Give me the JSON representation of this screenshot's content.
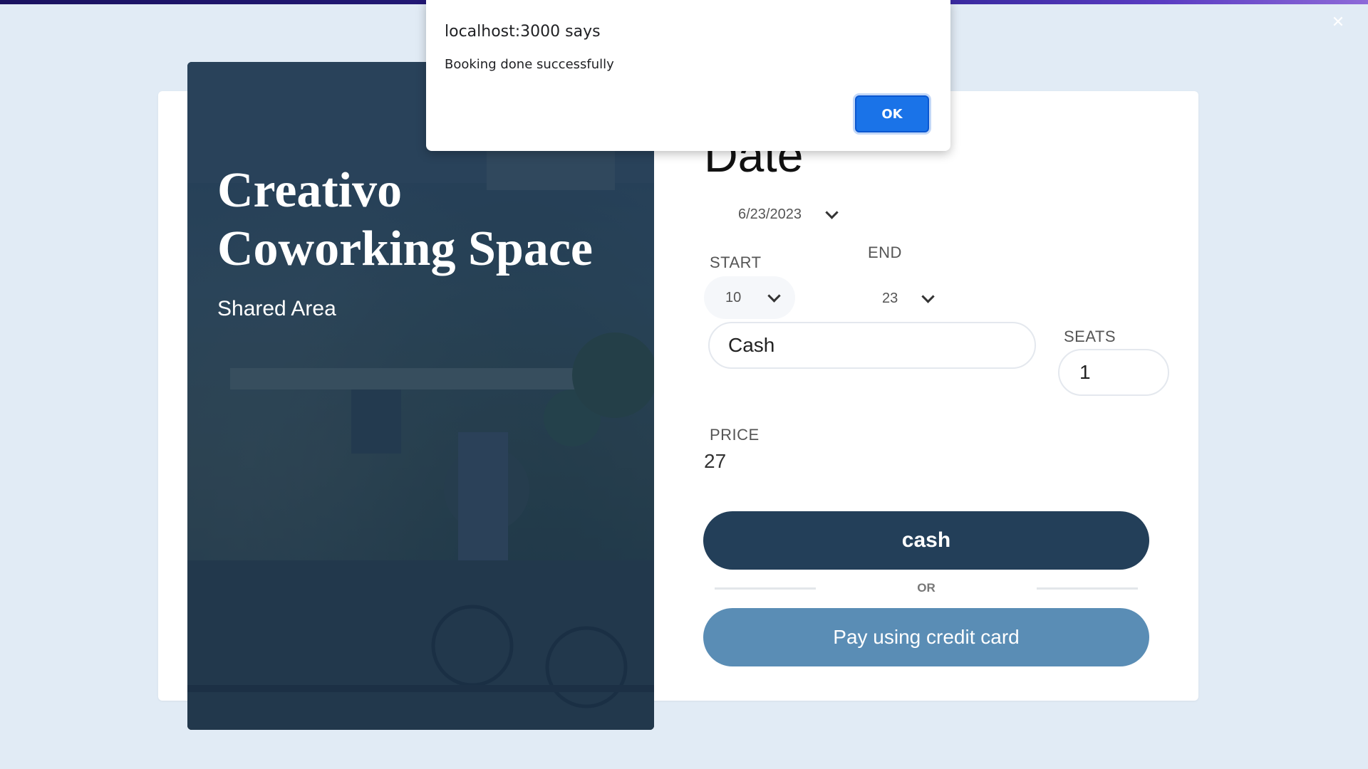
{
  "window": {
    "close_icon": "close-icon",
    "accent_gradient": [
      "#1a1260",
      "#8e6ad8"
    ]
  },
  "hero": {
    "title": "Creativo Coworking Space",
    "subtitle": "Shared Area"
  },
  "booking": {
    "date_heading": "Date",
    "date_value": "6/23/2023",
    "start_label": "START",
    "start_value": "10",
    "end_label": "END",
    "end_value": "23",
    "payment_value": "Cash",
    "seats_label": "SEATS",
    "seats_value": "1",
    "price_label": "PRICE",
    "price_value": "27",
    "cash_button": "cash",
    "or_text": "OR",
    "card_button": "Pay using credit card"
  },
  "alert": {
    "origin": "localhost:3000 says",
    "message": "Booking done successfully",
    "ok_label": "OK"
  },
  "colors": {
    "background": "#e1ebf5",
    "primary_button": "#233f59",
    "secondary_button": "#5a8db5",
    "dialog_ok": "#1a73e8"
  }
}
